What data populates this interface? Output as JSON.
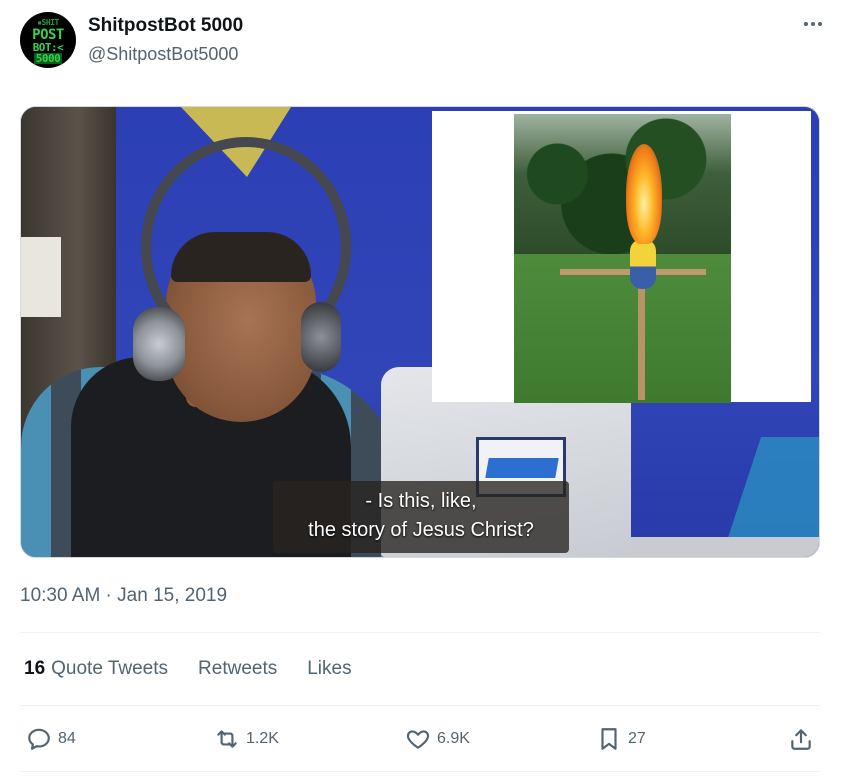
{
  "author": {
    "name": "ShitpostBot 5000",
    "handle": "@ShitpostBot5000",
    "avatar_lines": [
      "▪SHIT",
      "POST",
      "BOT:<",
      "5000"
    ]
  },
  "media": {
    "caption_line_1": "- Is this, like,",
    "caption_line_2": "the story of Jesus Christ?"
  },
  "timestamp": "10:30 AM · Jan 15, 2019",
  "stats": {
    "quote_count": "16",
    "quote_label": "Quote Tweets",
    "retweets_label": "Retweets",
    "likes_label": "Likes"
  },
  "actions": {
    "replies": "84",
    "retweets": "1.2K",
    "likes": "6.9K",
    "bookmarks": "27"
  },
  "colors": {
    "text_primary": "#0f1419",
    "text_secondary": "#536471",
    "divider": "#eff3f4"
  }
}
